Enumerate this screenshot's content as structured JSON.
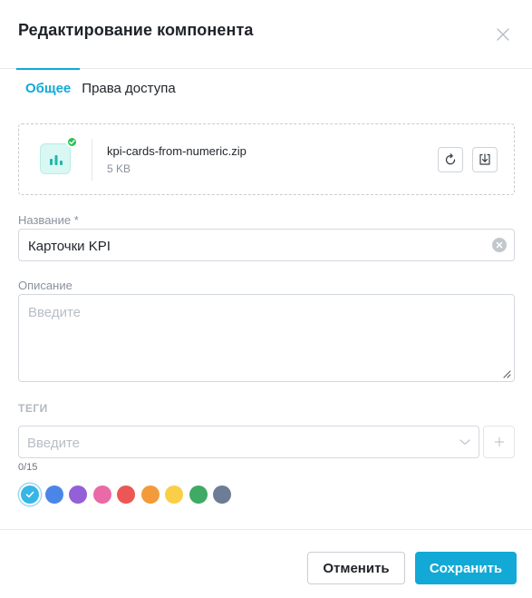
{
  "dialog": {
    "title": "Редактирование компонента"
  },
  "tabs": [
    {
      "label": "Общее",
      "active": true
    },
    {
      "label": "Права доступа",
      "active": false
    }
  ],
  "file": {
    "name": "kpi-cards-from-numeric.zip",
    "size": "5 KB",
    "icon": "bar-chart-icon",
    "status": "uploaded"
  },
  "name_field": {
    "label": "Название *",
    "value": "Карточки KPI"
  },
  "description_field": {
    "label": "Описание",
    "placeholder": "Введите"
  },
  "tags": {
    "label": "ТЕГИ",
    "placeholder": "Введите",
    "counter": "0/15"
  },
  "colors": [
    {
      "name": "light-blue",
      "hex": "#36b6e6",
      "selected": true
    },
    {
      "name": "blue",
      "hex": "#4a86e8",
      "selected": false
    },
    {
      "name": "purple",
      "hex": "#9360d8",
      "selected": false
    },
    {
      "name": "pink",
      "hex": "#e96aa6",
      "selected": false
    },
    {
      "name": "red",
      "hex": "#ec5656",
      "selected": false
    },
    {
      "name": "orange",
      "hex": "#f39a3a",
      "selected": false
    },
    {
      "name": "yellow",
      "hex": "#f8cf47",
      "selected": false
    },
    {
      "name": "green",
      "hex": "#3faa65",
      "selected": false
    },
    {
      "name": "slate",
      "hex": "#6c7d95",
      "selected": false
    }
  ],
  "footer": {
    "cancel_label": "Отменить",
    "save_label": "Сохранить"
  },
  "accent_color": "#12a9d6"
}
